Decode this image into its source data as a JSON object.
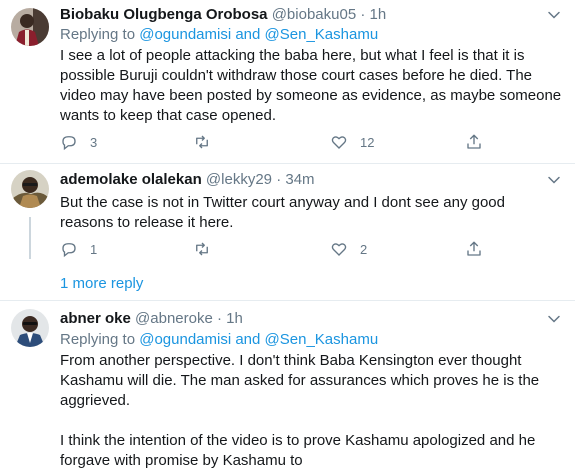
{
  "tweets": [
    {
      "name": "Biobaku Olugbenga Orobosa",
      "handle": "@biobaku05",
      "sep": "·",
      "time": "1h",
      "replying_prefix": "Replying to",
      "mention1": "@ogundamisi",
      "and": "and",
      "mention2": "@Sen_Kashamu",
      "body": [
        "I see a lot of people attacking the baba here, but what I feel is that it is possible Buruji couldn't withdraw those court cases before he died. The video may have been posted by someone as evidence, as maybe someone wants to keep that case opened."
      ],
      "replies": "3",
      "retweets": "",
      "likes": "12"
    },
    {
      "name": "ademolake olalekan",
      "handle": "@lekky29",
      "sep": "·",
      "time": "34m",
      "body": [
        "But the case is not in Twitter court anyway  and I dont see any good reasons to release it here."
      ],
      "replies": "1",
      "retweets": "",
      "likes": "2"
    },
    {
      "name": "abner oke",
      "handle": "@abneroke",
      "sep": "·",
      "time": "1h",
      "replying_prefix": "Replying to",
      "mention1": "@ogundamisi",
      "and": "and",
      "mention2": "@Sen_Kashamu",
      "body": [
        "From another perspective. I don't think Baba Kensington ever thought Kashamu will die. The man asked for assurances which proves he is the aggrieved.",
        "I think the intention of the video is to prove Kashamu apologized and he forgave with promise by Kashamu to"
      ]
    }
  ],
  "more_replies": "1 more reply",
  "colors": {
    "link": "#1b95e0",
    "meta": "#657786",
    "divider": "#e6ecf0"
  }
}
